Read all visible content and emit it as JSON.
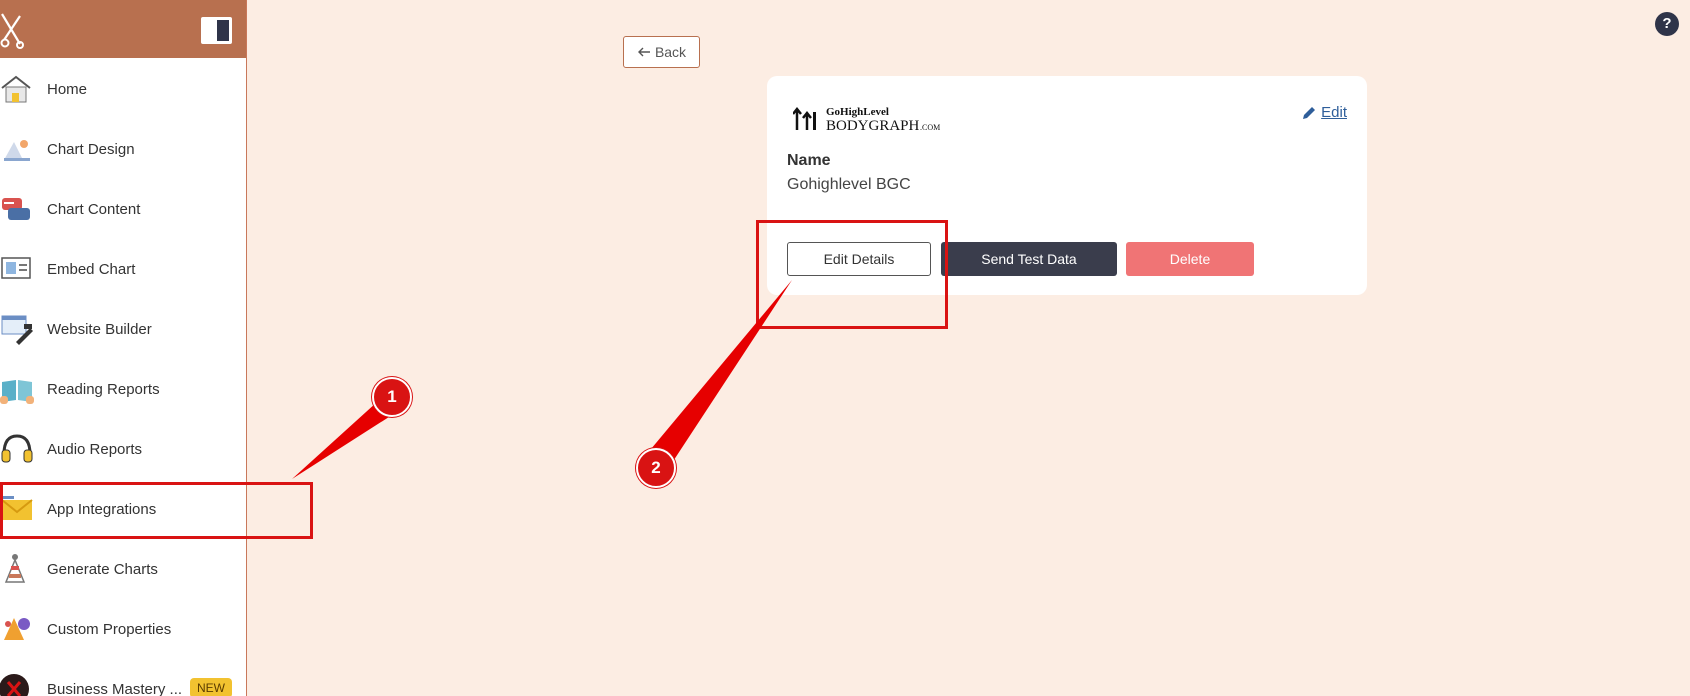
{
  "sidebar": {
    "items": [
      {
        "label": "Home",
        "icon": "home-icon"
      },
      {
        "label": "Chart Design",
        "icon": "chart-design-icon"
      },
      {
        "label": "Chart Content",
        "icon": "chart-content-icon"
      },
      {
        "label": "Embed Chart",
        "icon": "embed-chart-icon"
      },
      {
        "label": "Website Builder",
        "icon": "website-builder-icon"
      },
      {
        "label": "Reading Reports",
        "icon": "reading-reports-icon"
      },
      {
        "label": "Audio Reports",
        "icon": "headphones-icon"
      },
      {
        "label": "App Integrations",
        "icon": "envelope-icon"
      },
      {
        "label": "Generate Charts",
        "icon": "generate-charts-icon"
      },
      {
        "label": "Custom Properties",
        "icon": "custom-properties-icon"
      },
      {
        "label": "Business Mastery ...",
        "icon": "business-mastery-icon",
        "badge": "NEW"
      }
    ]
  },
  "header": {
    "back_label": "Back",
    "help_label": "?"
  },
  "card": {
    "brand_line1": "GoHighLevel",
    "brand_line2": "BODYGRAPH",
    "brand_suffix": ".COM",
    "edit_label": "Edit",
    "name_label": "Name",
    "name_value": "Gohighlevel BGC",
    "buttons": {
      "edit_details": "Edit Details",
      "send_test": "Send Test Data",
      "delete": "Delete"
    }
  },
  "annotations": {
    "step1": "1",
    "step2": "2"
  },
  "colors": {
    "background": "#fcede3",
    "sidebar_header": "#b8704f",
    "dark_button": "#3a3d4c",
    "delete_button": "#f07475",
    "annotation": "#d91313"
  }
}
